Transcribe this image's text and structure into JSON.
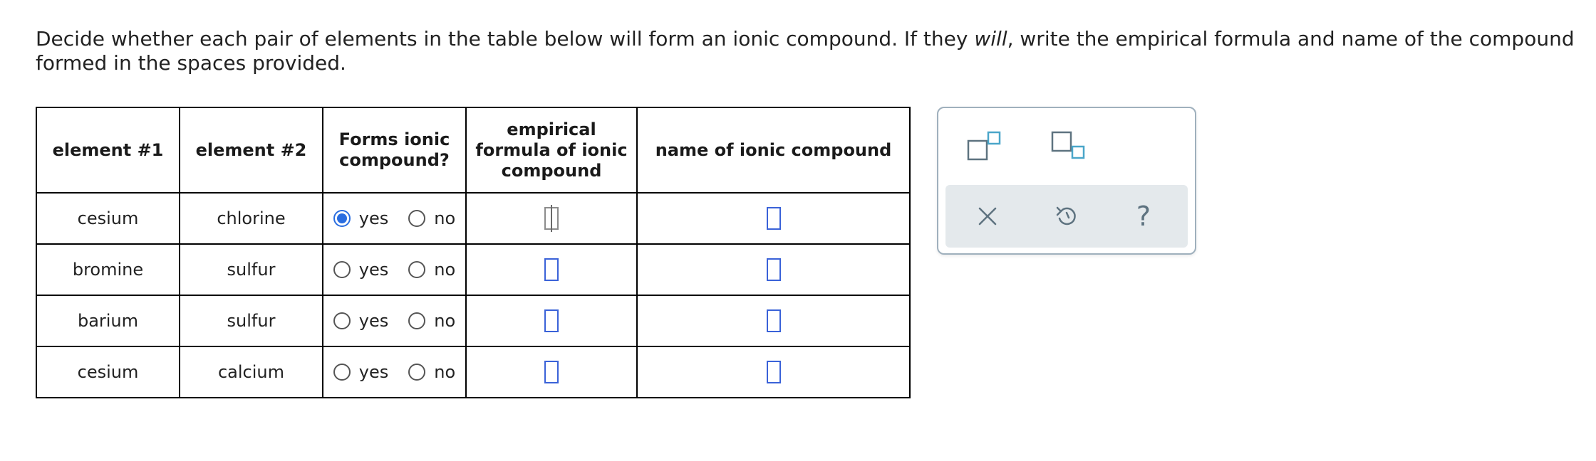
{
  "instructions": {
    "text_before": "Decide whether each pair of elements in the table below will form an ionic compound. If they ",
    "emphasis": "will",
    "text_after": ", write the empirical formula and name of the compound formed in the spaces provided."
  },
  "table": {
    "headers": {
      "element1": "element #1",
      "element2": "element #2",
      "forms_ionic_line1": "Forms ionic",
      "forms_ionic_line2": "compound?",
      "formula_line1": "empirical",
      "formula_line2": "formula of ionic",
      "formula_line3": "compound",
      "name": "name of ionic compound"
    },
    "radio_labels": {
      "yes": "yes",
      "no": "no"
    },
    "rows": [
      {
        "element1": "cesium",
        "element2": "chlorine",
        "forms_ionic": "yes",
        "formula": "",
        "name": ""
      },
      {
        "element1": "bromine",
        "element2": "sulfur",
        "forms_ionic": "",
        "formula": "",
        "name": ""
      },
      {
        "element1": "barium",
        "element2": "sulfur",
        "forms_ionic": "",
        "formula": "",
        "name": ""
      },
      {
        "element1": "cesium",
        "element2": "calcium",
        "forms_ionic": "",
        "formula": "",
        "name": ""
      }
    ]
  },
  "tools": {
    "superscript_icon": "superscript-icon",
    "subscript_icon": "subscript-icon",
    "clear_icon": "close-icon",
    "undo_icon": "undo-icon",
    "help_label": "?"
  },
  "colors": {
    "accent": "#2a6de0",
    "input_border": "#3a62d8",
    "tool_teal": "#4aa6c9",
    "tool_gray": "#5e7380",
    "toolbar_bg": "#e4e9ec"
  }
}
